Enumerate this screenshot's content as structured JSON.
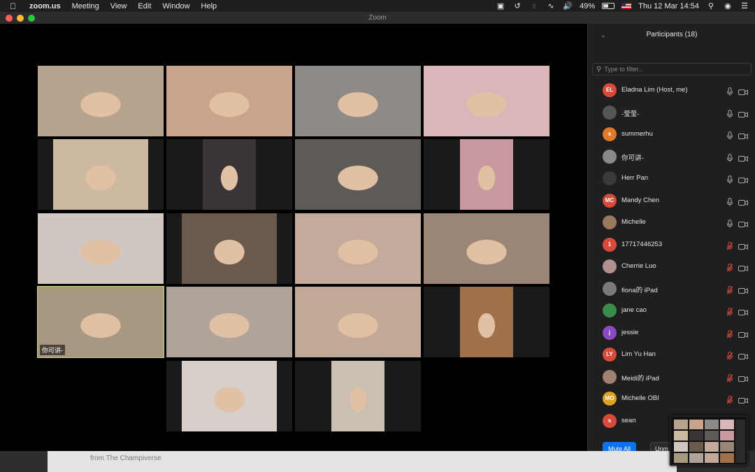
{
  "menubar": {
    "app": "zoom.us",
    "items": [
      "Meeting",
      "View",
      "Edit",
      "Window",
      "Help"
    ],
    "battery": "49%",
    "datetime": "Thu 12 Mar  14:54"
  },
  "window": {
    "title": "Zoom"
  },
  "gallery": {
    "active_name": "你可讲-",
    "tiles": [
      {
        "c": "#b7a48e"
      },
      {
        "c": "#c9a38a"
      },
      {
        "c": "#8f8a88"
      },
      {
        "c": "#d9b7b9"
      },
      {
        "c": "#cdb8a0"
      },
      {
        "c": "#3a3438"
      },
      {
        "c": "#5e5a56"
      },
      {
        "c": "#c89aa0"
      },
      {
        "c": "#cfc7c0"
      },
      {
        "c": "#6a5a4c"
      },
      {
        "c": "#c4aa9a"
      },
      {
        "c": "#9a8676"
      },
      {
        "c": "#a89882"
      },
      {
        "c": "#b0a49a"
      },
      {
        "c": "#c2a896"
      },
      {
        "c": "#a0704a"
      },
      {
        "c": "#d6cec8"
      },
      {
        "c": "#c9bfb2"
      }
    ]
  },
  "panel": {
    "title": "Participants (18)",
    "filter_placeholder": "Type to filter...",
    "participants": [
      {
        "name": "Eladna Lim (Host, me)",
        "initials": "EL",
        "color": "#d84a3a",
        "muted": false
      },
      {
        "name": "-莹莹-",
        "initials": "",
        "color": "#555555",
        "muted": false
      },
      {
        "name": "summerhu",
        "initials": "s",
        "color": "#e07a2a",
        "muted": false
      },
      {
        "name": "你可讲-",
        "initials": "",
        "color": "#8a8a8a",
        "muted": false
      },
      {
        "name": "Herr Pan",
        "initials": "",
        "color": "#3a3a3a",
        "muted": false
      },
      {
        "name": "Mandy Chen",
        "initials": "MC",
        "color": "#d84a3a",
        "muted": false
      },
      {
        "name": "Michelle",
        "initials": "",
        "color": "#9a7a5a",
        "muted": false
      },
      {
        "name": "17717446253",
        "initials": "1",
        "color": "#d84a3a",
        "muted": true
      },
      {
        "name": "Cherrie Luo",
        "initials": "",
        "color": "#b09090",
        "muted": true
      },
      {
        "name": "fiona的 iPad",
        "initials": "",
        "color": "#7a7a7a",
        "muted": true
      },
      {
        "name": "jane cao",
        "initials": "",
        "color": "#3a8a4a",
        "muted": true
      },
      {
        "name": "jessie",
        "initials": "j",
        "color": "#8a4ac0",
        "muted": true
      },
      {
        "name": "Lim Yu Han",
        "initials": "LY",
        "color": "#d84a3a",
        "muted": true
      },
      {
        "name": "Meidi的 iPad",
        "initials": "",
        "color": "#a08070",
        "muted": true
      },
      {
        "name": "Michelle OBI",
        "initials": "MO",
        "color": "#e0a020",
        "muted": true
      },
      {
        "name": "sean",
        "initials": "s",
        "color": "#d84a3a",
        "muted": true
      }
    ],
    "mute_all": "Mute All",
    "unmute_all": "Unm"
  },
  "background_app": {
    "text": "from The Champiverse"
  },
  "colors": {
    "accent": "#0e72ed",
    "muted_icon": "#d84a3a",
    "active_border": "#c8d87a"
  }
}
